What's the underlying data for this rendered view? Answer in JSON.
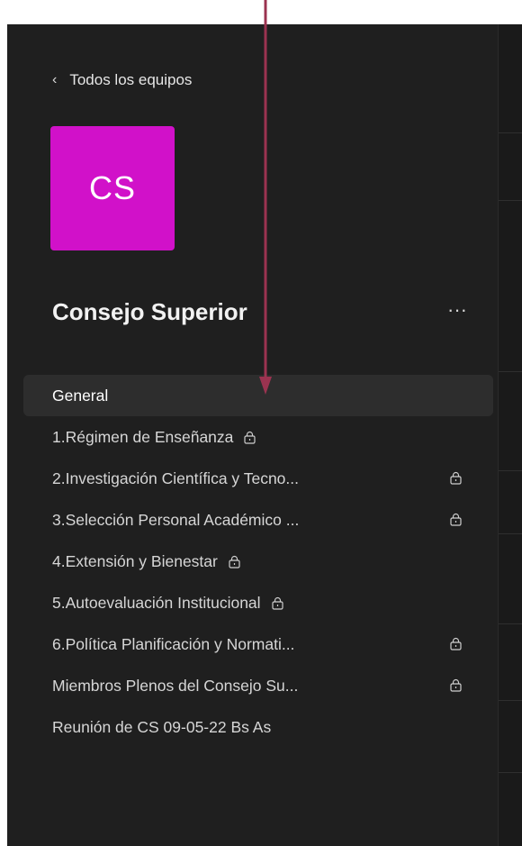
{
  "nav": {
    "back_label": "Todos los equipos"
  },
  "team": {
    "initials": "CS",
    "name": "Consejo Superior",
    "more_label": "···",
    "avatar_color": "#d111c9"
  },
  "channels": [
    {
      "label": "General",
      "active": true,
      "lock": "none"
    },
    {
      "label": "1.Régimen de Enseñanza",
      "lock": "inline"
    },
    {
      "label": "2.Investigación Científica y Tecno...",
      "lock": "right"
    },
    {
      "label": "3.Selección Personal Académico ...",
      "lock": "right"
    },
    {
      "label": "4.Extensión y Bienestar",
      "lock": "inline"
    },
    {
      "label": "5.Autoevaluación Institucional",
      "lock": "inline"
    },
    {
      "label": "6.Política Planificación y Normati...",
      "lock": "right"
    },
    {
      "label": "Miembros Plenos del Consejo Su...",
      "lock": "right"
    },
    {
      "label": "Reunión de CS 09-05-22 Bs As",
      "lock": "none"
    }
  ],
  "icons": {
    "back": "chevron-left-icon",
    "private": "lock-icon",
    "more": "more-icon"
  },
  "colors": {
    "sidebar_bg": "#1f1f1f",
    "active_bg": "#2d2d2d",
    "arrow": "#9b3350"
  }
}
